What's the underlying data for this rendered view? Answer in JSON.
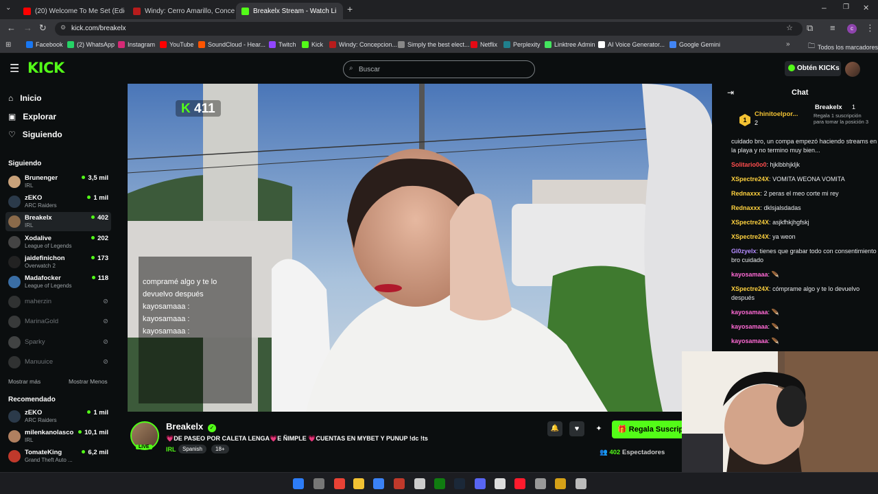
{
  "browser": {
    "tabs": [
      {
        "title": "(20) Welcome To Me Set (Edicio",
        "color": "#ff0000"
      },
      {
        "title": "Windy: Cerro Amarillo, Concep",
        "color": "#b71c1c"
      },
      {
        "title": "Breakelx Stream - Watch Li",
        "color": "#53fc18"
      }
    ],
    "url": "kick.com/breakelx",
    "bookmarks": [
      {
        "label": "Facebook",
        "color": "#1877f2"
      },
      {
        "label": "(2) WhatsApp",
        "color": "#25d366"
      },
      {
        "label": "Instagram",
        "color": "#d62976"
      },
      {
        "label": "YouTube",
        "color": "#ff0000"
      },
      {
        "label": "SoundCloud - Hear...",
        "color": "#ff5500"
      },
      {
        "label": "Twitch",
        "color": "#9146ff"
      },
      {
        "label": "Kick",
        "color": "#53fc18"
      },
      {
        "label": "Windy: Concepcion...",
        "color": "#b71c1c"
      },
      {
        "label": "Simply the best elect...",
        "color": "#888888"
      },
      {
        "label": "Netflix",
        "color": "#e50914"
      },
      {
        "label": "Perplexity",
        "color": "#20808d"
      },
      {
        "label": "Linktree Admin",
        "color": "#43e55e"
      },
      {
        "label": "AI Voice Generator...",
        "color": "#ffffff"
      },
      {
        "label": "Google Gemini",
        "color": "#4285f4"
      }
    ],
    "all_bookmarks": "Todos los marcadores"
  },
  "header": {
    "logo": "KICK",
    "search_placeholder": "Buscar",
    "kicks_button": "Obtén KICKs"
  },
  "sidebar": {
    "nav": [
      "Inicio",
      "Explorar",
      "Siguiendo"
    ],
    "following_title": "Siguiendo",
    "following": [
      {
        "name": "Brunenger",
        "category": "IRL",
        "viewers": "3,5 mil",
        "live": true,
        "color": "#c9a27a"
      },
      {
        "name": "zEKO",
        "category": "ARC Raiders",
        "viewers": "1 mil",
        "live": true,
        "color": "#2b3a4a"
      },
      {
        "name": "Breakelx",
        "category": "IRL",
        "viewers": "402",
        "live": true,
        "color": "#8a6a4a"
      },
      {
        "name": "Xodalive",
        "category": "League of Legends",
        "viewers": "202",
        "live": true,
        "color": "#444"
      },
      {
        "name": "jaidefinichon",
        "category": "Overwatch 2",
        "viewers": "173",
        "live": true,
        "color": "#222"
      },
      {
        "name": "Madafocker",
        "category": "League of Legends",
        "viewers": "118",
        "live": true,
        "color": "#3a6ea5"
      },
      {
        "name": "maherzin",
        "category": "",
        "viewers": "",
        "live": false,
        "color": "#555"
      },
      {
        "name": "MarinaGold",
        "category": "",
        "viewers": "",
        "live": false,
        "color": "#666"
      },
      {
        "name": "Sparky",
        "category": "",
        "viewers": "",
        "live": false,
        "color": "#777"
      },
      {
        "name": "Manuuice",
        "category": "",
        "viewers": "",
        "live": false,
        "color": "#555"
      }
    ],
    "show_more": "Mostrar más",
    "show_less": "Mostrar Menos",
    "recommended_title": "Recomendado",
    "recommended": [
      {
        "name": "zEKO",
        "category": "ARC Raiders",
        "viewers": "1 mil",
        "color": "#2b3a4a"
      },
      {
        "name": "milenkanolasco",
        "category": "IRL",
        "viewers": "10,1 mil",
        "color": "#b08060"
      },
      {
        "name": "TomateKing",
        "category": "Grand Theft Auto ...",
        "viewers": "6,2 mil",
        "color": "#c0392b"
      }
    ]
  },
  "stream": {
    "viewer_overlay": "411",
    "overlay_chat": [
      "compramé algo y te lo",
      "devuelvo después",
      "kayosamaaa :",
      "kayosamaaa :",
      "kayosamaaa :"
    ],
    "channel": "Breakelx",
    "live_label": "LIVE",
    "title": "💗DE PASEO POR CALETA LENGA💗E ÑIMPLE 💗CUENTAS EN MYBET Y PUNUP !dc !ts",
    "category": "IRL",
    "tags": [
      "Spanish",
      "18+"
    ],
    "gift_button": "Regala Suscrip",
    "viewers": "402",
    "viewers_label": "Espectadores"
  },
  "chat": {
    "title": "Chat",
    "pinned_gifter": {
      "name": "Chinitoelpor...",
      "count": "2"
    },
    "pinned_top": {
      "name": "Breakelx",
      "count": "1",
      "note": "Regala 1 suscripción para tomar la posición 3"
    },
    "messages": [
      {
        "user": "",
        "text": "cuidado bro, un compa empezó haciendo streams en la playa y no termino muy bien...",
        "color": "#8c6bff"
      },
      {
        "user": "Solitario0o0",
        "text": "hjklbbhjkljk",
        "color": "#ff4d4d"
      },
      {
        "user": "XSpectre24X",
        "text": "VOMITA WEONA VOMITA",
        "color": "#ffd23f"
      },
      {
        "user": "Rednaxxx",
        "text": "2 peras el meo corte mi rey",
        "color": "#ffd23f"
      },
      {
        "user": "Rednaxxx",
        "text": "dklsjalsdadas",
        "color": "#ffd23f"
      },
      {
        "user": "XSpectre24X",
        "text": "asjkfhkjhgfskj",
        "color": "#ffd23f"
      },
      {
        "user": "XSpectre24X",
        "text": "ya weon",
        "color": "#ffd23f"
      },
      {
        "user": "Gl0zyelx",
        "text": "tienes que grabar todo con consentimiento bro cuidado",
        "color": "#b48cff"
      },
      {
        "user": "kayosamaaa",
        "text": "",
        "color": "#ff6ad5"
      },
      {
        "user": "XSpectre24X",
        "text": "cómprame algo y te lo devuelvo después",
        "color": "#ffd23f"
      },
      {
        "user": "kayosamaaa",
        "text": "",
        "color": "#ff6ad5"
      },
      {
        "user": "kayosamaaa",
        "text": "",
        "color": "#ff6ad5"
      },
      {
        "user": "kayosamaaa",
        "text": "",
        "color": "#ff6ad5"
      }
    ]
  },
  "colors": {
    "kick_green": "#53fc18",
    "bg": "#0b0e0f"
  }
}
